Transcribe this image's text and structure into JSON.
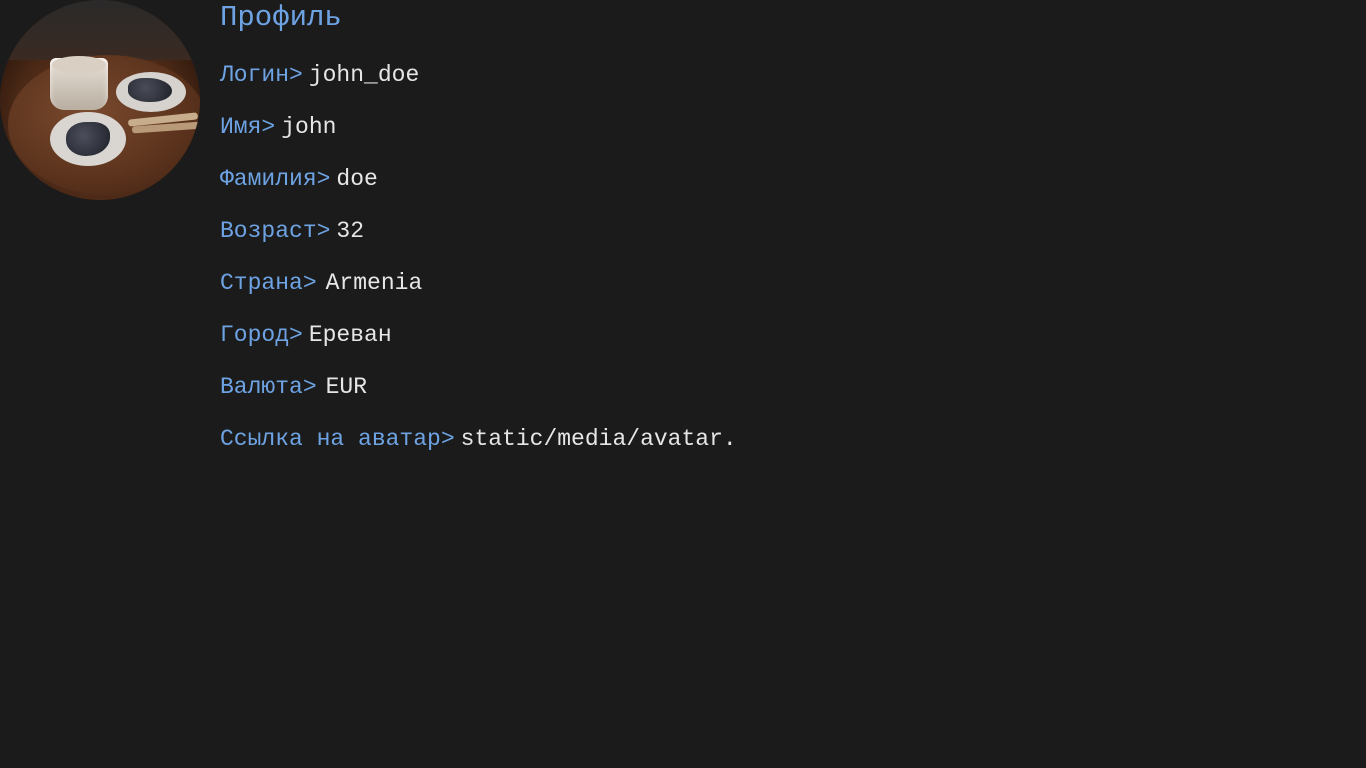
{
  "profile": {
    "title": "Профиль",
    "avatar_alt": "avatar",
    "fields": [
      {
        "label": "Логин>",
        "value": "john_doe"
      },
      {
        "label": "Имя>",
        "value": "john"
      },
      {
        "label": "Фамилия>",
        "value": "doe"
      },
      {
        "label": "Возраст>",
        "value": "32"
      },
      {
        "label": "Страна>",
        "value": "Armenia"
      },
      {
        "label": "Город>",
        "value": "Ереван"
      },
      {
        "label": "Валюта>",
        "value": "EUR"
      },
      {
        "label": "Ссылка на аватар>",
        "value": "static/media/avatar."
      }
    ]
  },
  "colors": {
    "background": "#1b1b1b",
    "accent": "#6ea3e3",
    "text": "#e6e6e6"
  }
}
